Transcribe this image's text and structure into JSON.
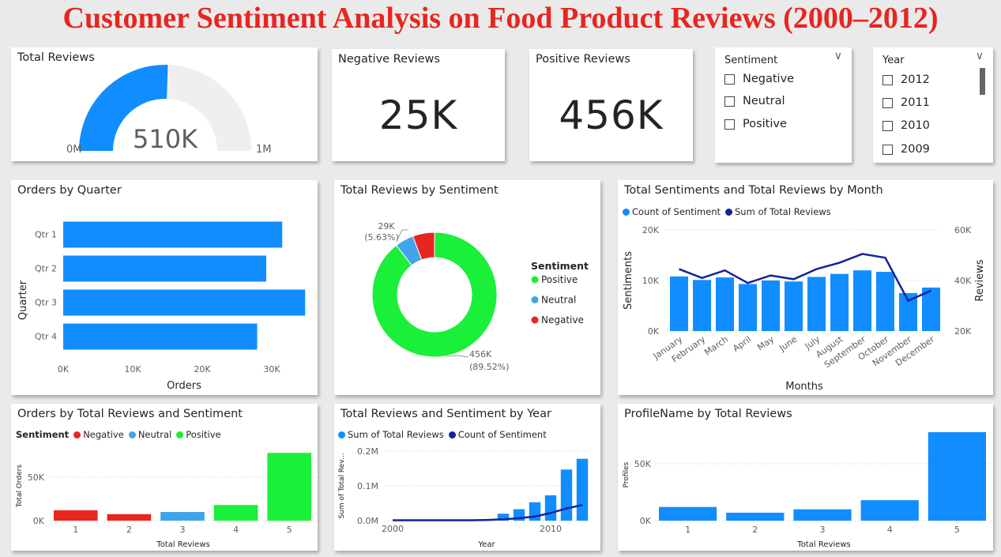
{
  "page_title": "Customer Sentiment Analysis on Food Product Reviews (2000–2012)",
  "colors": {
    "primary": "#118dff",
    "dark_line": "#12239e",
    "positive": "#1aef3a",
    "neutral": "#41a4e8",
    "negative": "#e8251f",
    "gauge_bg": "#f0efee"
  },
  "kpi_total": {
    "title": "Total Reviews",
    "value": "510K",
    "min": "0M",
    "max": "1M",
    "fraction": 0.51
  },
  "kpi_negative": {
    "title": "Negative Reviews",
    "value": "25K"
  },
  "kpi_positive": {
    "title": "Positive Reviews",
    "value": "456K"
  },
  "slicer_sentiment": {
    "title": "Sentiment",
    "options": [
      "Negative",
      "Neutral",
      "Positive"
    ]
  },
  "slicer_year": {
    "title": "Year",
    "options": [
      "2012",
      "2011",
      "2010",
      "2009"
    ]
  },
  "chart_data": [
    {
      "id": "orders_by_quarter",
      "type": "bar",
      "orientation": "horizontal",
      "title": "Orders by Quarter",
      "categories": [
        "Qtr 1",
        "Qtr 2",
        "Qtr 3",
        "Qtr 4"
      ],
      "values": [
        31500,
        29200,
        34800,
        27900
      ],
      "xlabel": "Orders",
      "ylabel": "Quarter",
      "xticks": [
        "0K",
        "10K",
        "20K",
        "30K"
      ],
      "xlim": [
        0,
        35000
      ],
      "grid": false
    },
    {
      "id": "reviews_by_sentiment",
      "type": "pie",
      "donut": true,
      "title": "Total Reviews by Sentiment",
      "categories": [
        "Positive",
        "Neutral",
        "Negative"
      ],
      "values": [
        89.52,
        4.85,
        5.63
      ],
      "legend_title": "Sentiment",
      "labels": {
        "small": "29K",
        "small_pct": "(5.63%)",
        "large": "456K",
        "large_pct": "(89.52%)"
      }
    },
    {
      "id": "sentiments_reviews_by_month",
      "type": "bar",
      "title": "Total Sentiments and Total Reviews by Month",
      "legend": [
        "Count of Sentiment",
        "Sum of Total Reviews"
      ],
      "categories": [
        "January",
        "February",
        "March",
        "April",
        "May",
        "June",
        "July",
        "August",
        "September",
        "October",
        "November",
        "December"
      ],
      "bar_values": [
        10800,
        10100,
        10600,
        9300,
        10000,
        9800,
        10700,
        11300,
        12000,
        11700,
        7500,
        8600
      ],
      "line_values": [
        44500,
        41000,
        44000,
        39000,
        42000,
        40500,
        44500,
        47000,
        50500,
        49000,
        32000,
        36000
      ],
      "xlabel": "Months",
      "ylabel": "Sentiments",
      "y2label": "Reviews",
      "yticks": [
        "0K",
        "10K",
        "20K"
      ],
      "y2ticks": [
        "20K",
        "40K",
        "60K"
      ],
      "ylim": [
        0,
        20000
      ],
      "y2lim": [
        20000,
        60000
      ],
      "grid": true
    },
    {
      "id": "orders_by_reviews_sentiment",
      "type": "bar",
      "title": "Orders by Total Reviews and Sentiment",
      "legend_title": "Sentiment",
      "legend": [
        "Negative",
        "Neutral",
        "Positive"
      ],
      "categories": [
        "1",
        "2",
        "3",
        "4",
        "5"
      ],
      "values": [
        12000,
        7500,
        10000,
        18000,
        78000
      ],
      "bar_sentiment": [
        "Negative",
        "Negative",
        "Neutral",
        "Positive",
        "Positive"
      ],
      "xlabel": "Total Reviews",
      "ylabel": "Total Orders",
      "yticks": [
        "0K",
        "50K"
      ],
      "ylim": [
        0,
        80000
      ],
      "grid": true
    },
    {
      "id": "reviews_sentiment_by_year",
      "type": "bar",
      "title": "Total Reviews and Sentiment by Year",
      "legend": [
        "Sum of Total Reviews",
        "Count of Sentiment"
      ],
      "x": [
        2000,
        2001,
        2002,
        2003,
        2004,
        2005,
        2006,
        2007,
        2008,
        2009,
        2010,
        2011,
        2012
      ],
      "bar_values": [
        0,
        0,
        0,
        0,
        0,
        0,
        0,
        20000,
        33000,
        53000,
        73000,
        147000,
        178000
      ],
      "line_values": [
        1000,
        1000,
        1000,
        1000,
        1000,
        1000,
        2000,
        4000,
        7000,
        12000,
        22000,
        35000,
        45000
      ],
      "xticks": [
        "2000",
        "2010"
      ],
      "xlabel": "Year",
      "ylabel": "Sum of Total Rev...",
      "yticks": [
        "0.0M",
        "0.1M",
        "0.2M"
      ],
      "ylim": [
        0,
        200000
      ],
      "grid": true
    },
    {
      "id": "profilename_by_reviews",
      "type": "bar",
      "title": "ProfileName by Total Reviews",
      "categories": [
        "1",
        "2",
        "3",
        "4",
        "5"
      ],
      "values": [
        12000,
        7000,
        10000,
        18000,
        78000
      ],
      "xlabel": "Total Reviews",
      "ylabel": "Profiles",
      "yticks": [
        "0K",
        "50K"
      ],
      "ylim": [
        0,
        80000
      ],
      "grid": true
    }
  ]
}
